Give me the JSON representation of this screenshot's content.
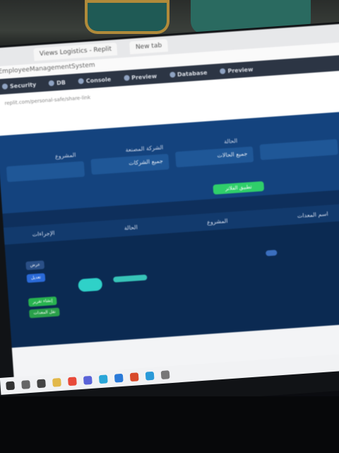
{
  "browser": {
    "tabs": [
      "Views Logistics - Replit",
      "New tab"
    ],
    "url": "EmployeeManagementSystem",
    "extensions": [
      "Security",
      "DB",
      "Console",
      "Preview",
      "Database",
      "Preview"
    ]
  },
  "repo_link": "replit.com/personal-safe/share-link",
  "filter_panel": {
    "fields": [
      {
        "label": "المشروع",
        "value": ""
      },
      {
        "label": "الشركة المصنعة",
        "value": "جميع الشركات"
      },
      {
        "label": "الحالة",
        "value": "جميع الحالات"
      },
      {
        "label": "",
        "value": ""
      }
    ],
    "apply_label": "تطبيق الفلاتر"
  },
  "table_panel": {
    "columns": [
      "الإجراءات",
      "الحالة",
      "المشروع",
      "اسم المعدات"
    ],
    "actions": [
      {
        "label": "عرض",
        "color": "#2a4f86"
      },
      {
        "label": "تعديل",
        "color": "#2a6ad8"
      },
      {
        "label": "إنشاء تقرير",
        "color": "#28b34f"
      },
      {
        "label": "نقل المعدات",
        "color": "#2aa04a"
      }
    ]
  },
  "colors": {
    "panel": "#14437e",
    "table_bg": "#0b2a52",
    "accent_green": "#2fcf6a",
    "badge_teal": "#2fd1c8"
  }
}
